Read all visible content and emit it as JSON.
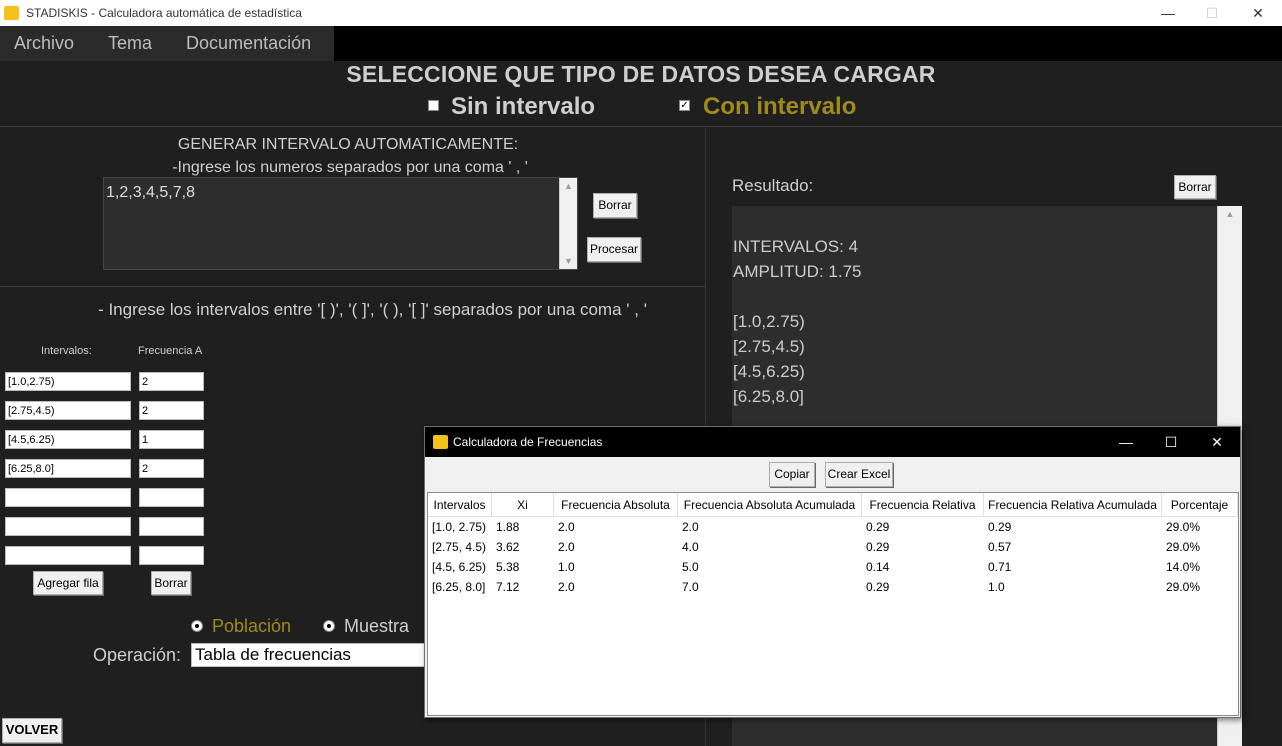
{
  "titlebar": {
    "title": "STADISKIS - Calculadora automática de estadística",
    "minimize": "—",
    "maximize": "☐",
    "close": "✕"
  },
  "menu": [
    "Archivo",
    "Tema",
    "Documentación"
  ],
  "header": {
    "heading": "SELECCIONE QUE TIPO DE DATOS DESEA CARGAR",
    "option_sin": "Sin intervalo",
    "option_con": "Con intervalo",
    "option_con_checked": true
  },
  "auto": {
    "title": "GENERAR INTERVALO AUTOMATICAMENTE:",
    "instruction": "-Ingrese los numeros separados por una coma ' , '",
    "input_value": "1,2,3,4,5,7,8",
    "borrar": "Borrar",
    "procesar": "Procesar"
  },
  "manual": {
    "instruction": "- Ingrese los intervalos entre '[ )', '( ]', '( ), '[ ]' separados por una coma ' , '",
    "col_intervalos": "Intervalos:",
    "col_frecuencia": "Frecuencia A",
    "rows": [
      {
        "intervalo": "[1.0,2.75)",
        "frecuencia": "2"
      },
      {
        "intervalo": "[2.75,4.5)",
        "frecuencia": "2"
      },
      {
        "intervalo": "[4.5,6.25)",
        "frecuencia": "1"
      },
      {
        "intervalo": "[6.25,8.0]",
        "frecuencia": "2"
      },
      {
        "intervalo": "",
        "frecuencia": ""
      },
      {
        "intervalo": "",
        "frecuencia": ""
      },
      {
        "intervalo": "",
        "frecuencia": ""
      }
    ],
    "agregar": "Agregar fila",
    "borrar": "Borrar"
  },
  "mode": {
    "poblacion": "Población",
    "muestra": "Muestra",
    "selected": "poblacion"
  },
  "operacion": {
    "label": "Operación:",
    "value": "Tabla de frecuencias"
  },
  "volver": "VOLVER",
  "result": {
    "label": "Resultado:",
    "borrar": "Borrar",
    "lines": [
      "INTERVALOS: 4",
      "AMPLITUD: 1.75",
      "",
      "[1.0,2.75)",
      "[2.75,4.5)",
      "[4.5,6.25)",
      "[6.25,8.0]"
    ]
  },
  "popup": {
    "title": "Calculadora de Frecuencias",
    "copiar": "Copiar",
    "crear_excel": "Crear Excel",
    "columns": [
      "Intervalos",
      "Xi",
      "Frecuencia Absoluta",
      "Frecuencia Absoluta Acumulada",
      "Frecuencia Relativa",
      "Frecuencia Relativa Acumulada",
      "Porcentaje"
    ],
    "rows": [
      [
        "[1.0, 2.75)",
        "1.88",
        "2.0",
        "2.0",
        "0.29",
        "0.29",
        "29.0%"
      ],
      [
        "[2.75, 4.5)",
        "3.62",
        "2.0",
        "4.0",
        "0.29",
        "0.57",
        "29.0%"
      ],
      [
        "[4.5, 6.25)",
        "5.38",
        "1.0",
        "5.0",
        "0.14",
        "0.71",
        "14.0%"
      ],
      [
        "[6.25, 8.0]",
        "7.12",
        "2.0",
        "7.0",
        "0.29",
        "1.0",
        "29.0%"
      ]
    ]
  },
  "colors": {
    "accent_gold": "#a08a1e",
    "text_light": "#cfcfcf",
    "bg_dark": "#1f1f1f",
    "logo_yellow": "#f4c21a"
  }
}
